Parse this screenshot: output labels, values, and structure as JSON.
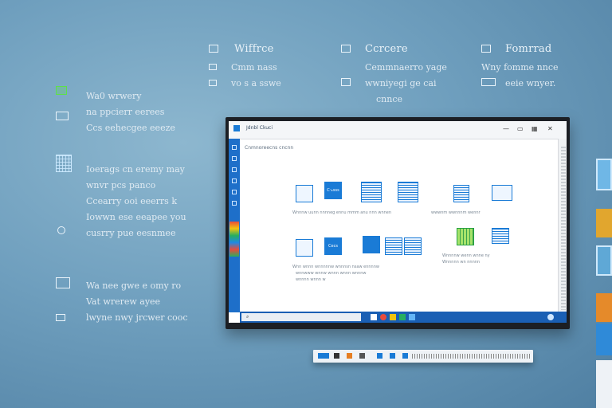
{
  "features": [
    {
      "title": "Wiffrce",
      "lines": [
        "Cmm nass",
        "vo s a sswe"
      ]
    },
    {
      "title": "Ccrcere",
      "lines": [
        "Cemmnaerro yage",
        "wwniyegi ge cai",
        "cnnce"
      ]
    },
    {
      "title": "Fomrrad",
      "lines": [
        "Wny fomme nnce",
        "eeie wnyer."
      ]
    }
  ],
  "left_features": [
    {
      "lines": [
        "Wa0 wrwery",
        "na ppcierr eerees",
        "Ccs eehecgee eeeze"
      ]
    },
    {
      "lines": [
        "Ioerags cn eremy may",
        "wnvr pcs panco",
        "Ccearry ooi eeerrs k",
        "Iowwn ese eeapee you",
        "cusrry pue eesnmee"
      ]
    },
    {
      "lines": [
        "Wa nee gwe e omy ro",
        "Vat wrerew ayee",
        "lwyne nwy jrcwer cooc"
      ]
    }
  ],
  "window": {
    "tab": "Jdnbl Ckuci",
    "doc_head": "Cnmnoreecns cncnn",
    "tile_a_label": "C↘sss",
    "tile_b_label": "Cecs",
    "captions": [
      "Wnnnw uunn nnnneg ennu mmm anu nnn wnnen",
      "wwwnm wwnnnm wennr",
      "Wnnnnw wenn wnne ny",
      "Wnn wnnn wnnnnnw wnnnsn nsaw ennnnw",
      "wnnwww wnnw wnnn wnnn wnnnw",
      "Wnnnnn wn nnnnn",
      "wnnnn wnnn w"
    ]
  },
  "colors": {
    "accent": "#1a7bd6",
    "taskbar": "#1a5fb4",
    "background": "#6f9fbe"
  }
}
